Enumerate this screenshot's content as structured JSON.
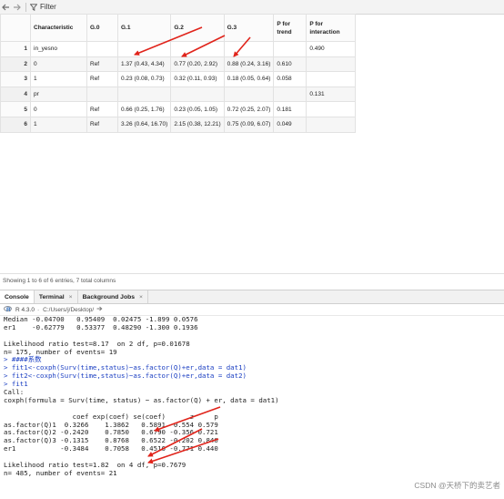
{
  "toolbar": {
    "back_icon": "back-arrow-icon",
    "forward_icon": "forward-arrow-icon",
    "filter_label": "Filter"
  },
  "table": {
    "columns": [
      "",
      "Characteristic",
      "G.0",
      "G.1",
      "G.2",
      "G.3",
      "P for trend",
      "P for interaction"
    ],
    "rows": [
      [
        "1",
        "in_yesno",
        "",
        "",
        "",
        "",
        "",
        "0.490"
      ],
      [
        "2",
        "0",
        "Ref",
        "1.37 (0.43, 4.34)",
        "0.77 (0.20, 2.92)",
        "0.88 (0.24, 3.16)",
        "0.610",
        ""
      ],
      [
        "3",
        "1",
        "Ref",
        "0.23 (0.08, 0.73)",
        "0.32 (0.11, 0.93)",
        "0.18 (0.05, 0.64)",
        "0.058",
        ""
      ],
      [
        "4",
        "pr",
        "",
        "",
        "",
        "",
        "",
        "0.131"
      ],
      [
        "5",
        "0",
        "Ref",
        "0.66 (0.25, 1.76)",
        "0.23 (0.05, 1.05)",
        "0.72 (0.25, 2.07)",
        "0.181",
        ""
      ],
      [
        "6",
        "1",
        "Ref",
        "3.26 (0.64, 16.70)",
        "2.15 (0.38, 12.21)",
        "0.75 (0.09, 6.07)",
        "0.049",
        ""
      ]
    ]
  },
  "status": "Showing 1 to 6 of 6 entries, 7 total columns",
  "tabs": [
    {
      "label": "Console",
      "close": ""
    },
    {
      "label": "Terminal",
      "close": "×"
    },
    {
      "label": "Background Jobs",
      "close": "×"
    }
  ],
  "pathbar": {
    "version": "R 4.3.0",
    "separator": "·",
    "path": "C:/Users/j/Desktop/",
    "arrow_icon": "go-to-directory-icon"
  },
  "console_lines": [
    {
      "text": "Median -0.04700   0.95409  0.02475 -1.899 0.0576",
      "kind": "out"
    },
    {
      "text": "er1    -0.62779   0.53377  0.48290 -1.300 0.1936",
      "kind": "out"
    },
    {
      "text": "",
      "kind": "spacer"
    },
    {
      "text": "Likelihood ratio test=8.17  on 2 df, p=0.01678",
      "kind": "out"
    },
    {
      "text": "n= 175, number of events= 19",
      "kind": "out"
    },
    {
      "text": "> ####系数",
      "kind": "cmd"
    },
    {
      "text": "> fit1<-coxph(Surv(time,status)~as.factor(Q)+er,data = dat1)",
      "kind": "cmd"
    },
    {
      "text": "> fit2<-coxph(Surv(time,status)~as.factor(Q)+er,data = dat2)",
      "kind": "cmd"
    },
    {
      "text": "> fit1",
      "kind": "cmd"
    },
    {
      "text": "Call:",
      "kind": "out"
    },
    {
      "text": "coxph(formula = Surv(time, status) ~ as.factor(Q) + er, data = dat1)",
      "kind": "out"
    },
    {
      "text": "",
      "kind": "spacer"
    },
    {
      "text": "                 coef exp(coef) se(coef)      z     p",
      "kind": "out"
    },
    {
      "text": "as.factor(Q)1  0.3266    1.3862   0.5891  0.554 0.579",
      "kind": "out"
    },
    {
      "text": "as.factor(Q)2 -0.2420    0.7850   0.6790 -0.356 0.721",
      "kind": "out"
    },
    {
      "text": "as.factor(Q)3 -0.1315    0.8768   0.6522 -0.202 0.840",
      "kind": "out"
    },
    {
      "text": "er1           -0.3484    0.7058   0.4516 -0.771 0.440",
      "kind": "out"
    },
    {
      "text": "",
      "kind": "spacer"
    },
    {
      "text": "Likelihood ratio test=1.82  on 4 df, p=0.7679",
      "kind": "out"
    },
    {
      "text": "n= 485, number of events= 21",
      "kind": "out"
    }
  ],
  "annotation_color": "#e0241b",
  "watermark": "CSDN @天桥下的卖艺者"
}
